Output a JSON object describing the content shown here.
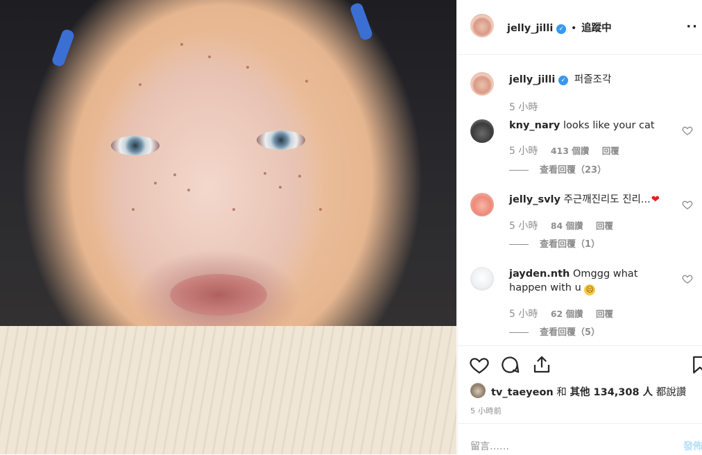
{
  "header": {
    "username": "jelly_jilli",
    "separator": "•",
    "follow_status": "追蹤中"
  },
  "caption": {
    "username": "jelly_jilli",
    "text": "퍼즐조각",
    "time": "5 小時"
  },
  "comments": [
    {
      "username": "kny_nary",
      "text": "looks like your cat",
      "time": "5 小時",
      "likes": "413 個讚",
      "reply": "回覆",
      "view_replies": "查看回覆（23）"
    },
    {
      "username": "jelly_svly",
      "text": "주근깨진리도 진리...",
      "time": "5 小時",
      "likes": "84 個讚",
      "reply": "回覆",
      "view_replies": "查看回覆（1）"
    },
    {
      "username": "jayden.nth",
      "text": "Omggg what happen with u",
      "time": "5 小時",
      "likes": "62 個讚",
      "reply": "回覆",
      "view_replies": "查看回覆（5）"
    }
  ],
  "likes": {
    "username": "tv_taeyeon",
    "connector": "和",
    "others": "其他 134,308 人",
    "suffix": "都說讚"
  },
  "post_time": "5 小時前",
  "composer": {
    "placeholder": "留言……",
    "post_label": "發佈"
  },
  "colors": {
    "link": "#3897f0",
    "muted": "#8e8e8e",
    "text": "#262626",
    "heart": "#ed4956"
  }
}
